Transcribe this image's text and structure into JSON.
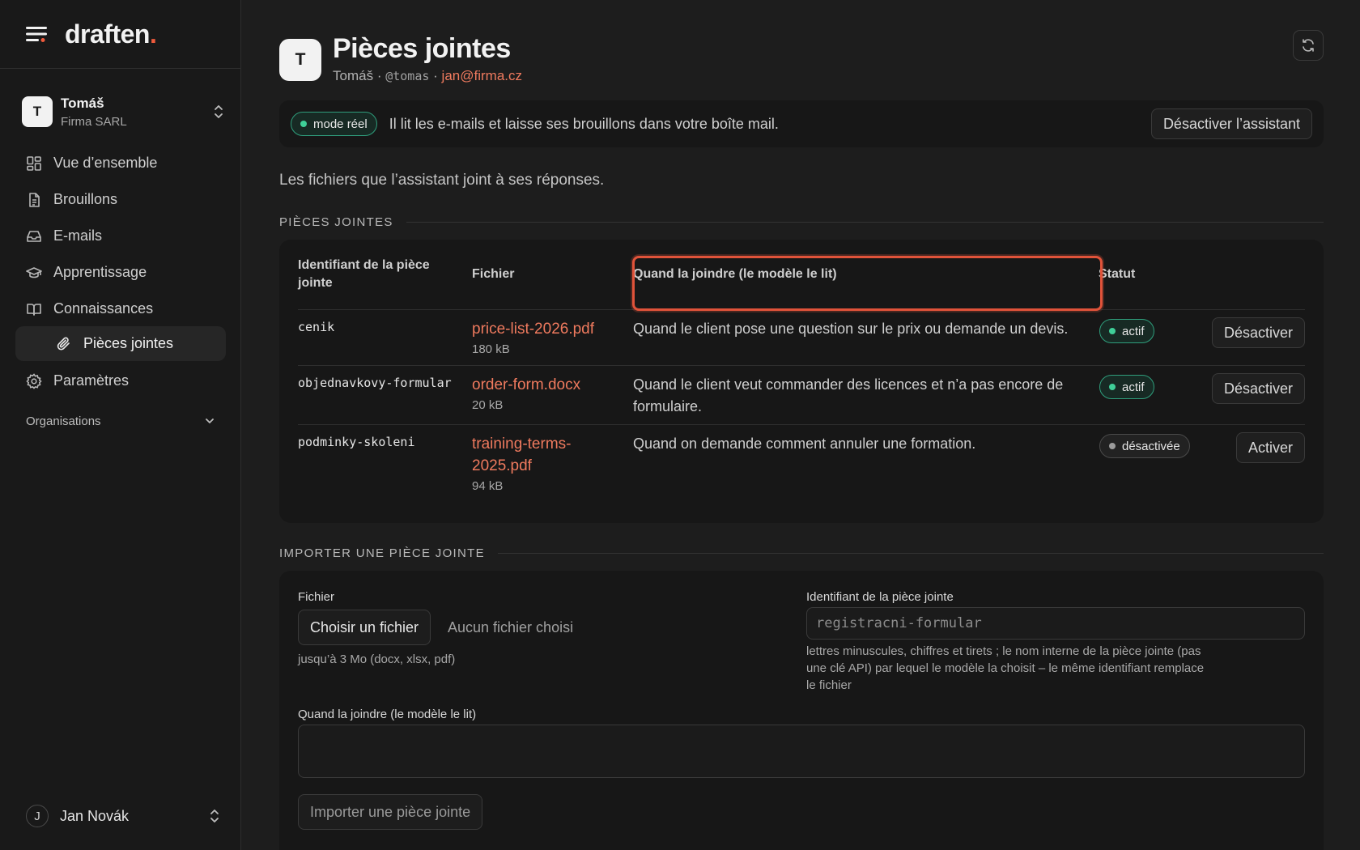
{
  "brand": {
    "name": "draften",
    "dot": "."
  },
  "org": {
    "avatar": "T",
    "user": "Tomáš",
    "company": "Firma SARL"
  },
  "nav": [
    {
      "label": "Vue d’ensemble",
      "icon": "grid-icon"
    },
    {
      "label": "Brouillons",
      "icon": "file-text-icon"
    },
    {
      "label": "E-mails",
      "icon": "inbox-icon"
    },
    {
      "label": "Apprentissage",
      "icon": "graduation-cap-icon"
    },
    {
      "label": "Connaissances",
      "icon": "book-open-icon"
    },
    {
      "label": "Pièces jointes",
      "icon": "paperclip-icon"
    },
    {
      "label": "Paramètres",
      "icon": "gear-icon"
    }
  ],
  "organisations_label": "Organisations",
  "footer_user": {
    "avatar": "J",
    "name": "Jan Novák"
  },
  "header": {
    "avatar": "T",
    "title": "Pièces jointes",
    "user": "Tomáš",
    "sep": "·",
    "handle": "@tomas",
    "email": "jan@firma.cz"
  },
  "mode": {
    "badge": "mode réel",
    "text": "Il lit les e-mails et laisse ses brouillons dans votre boîte mail.",
    "button": "Désactiver l’assistant"
  },
  "description": "Les fichiers que l’assistant joint à ses réponses.",
  "attachments_section": "PIÈCES JOINTES",
  "table": {
    "headers": {
      "id": "Identifiant de la pièce jointe",
      "file": "Fichier",
      "when": "Quand la joindre (le modèle le lit)",
      "status": "Statut"
    },
    "rows": [
      {
        "id": "cenik",
        "file": "price-list-2026.pdf",
        "size": "180 kB",
        "when": "Quand le client pose une question sur le prix ou demande un devis.",
        "status": "actif",
        "action": "Désactiver",
        "active": true
      },
      {
        "id": "objednavkovy-formular",
        "file": "order-form.docx",
        "size": "20 kB",
        "when": "Quand le client veut commander des licences et n’a pas encore de formulaire.",
        "status": "actif",
        "action": "Désactiver",
        "active": true
      },
      {
        "id": "podminky-skoleni",
        "file": "training-terms-2025.pdf",
        "size": "94 kB",
        "when": "Quand on demande comment annuler une formation.",
        "status": "désactivée",
        "action": "Activer",
        "active": false
      }
    ]
  },
  "import_section": "IMPORTER UNE PIÈCE JOINTE",
  "form": {
    "file_label": "Fichier",
    "file_button": "Choisir un fichier",
    "no_file": "Aucun fichier choisi",
    "file_help": "jusqu’à 3 Mo (docx, xlsx, pdf)",
    "id_label": "Identifiant de la pièce jointe",
    "id_placeholder": "registracni-formular",
    "id_help": "lettres minuscules, chiffres et tirets ; le nom interne de la pièce jointe (pas une clé API) par lequel le modèle la choisit – le même identifiant remplace le fichier",
    "when_label": "Quand la joindre (le modèle le lit)",
    "when_value": "",
    "submit": "Importer une pièce jointe"
  },
  "colors": {
    "accent": "#ef7a5e",
    "highlight": "#e0533a",
    "active": "#3fcf98",
    "bg": "#1d1d1d"
  }
}
